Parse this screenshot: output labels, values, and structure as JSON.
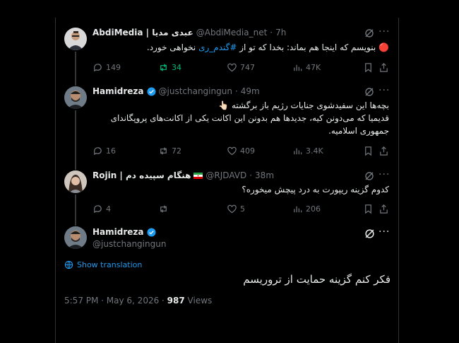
{
  "tweets": [
    {
      "name": "AbdiMedia | عبدی مدیا",
      "handle": "@AbdiMedia_net",
      "time": "7h",
      "text_before": "بنویسم که اینجا هم بماند: بخدا که تو از ",
      "hashtag": "#گندم_ری",
      "text_after": " نخواهی خورد.",
      "status_emoji": "🔴",
      "replies": "149",
      "reposts": "34",
      "likes": "747",
      "views": "47K"
    },
    {
      "name": "Hamidreza",
      "handle": "@justchangingun",
      "time": "49m",
      "line1": "بچه‌ها این سفیدشوی جنایات رژیم باز برگشته 👆🏻",
      "line2": "قدیمیا که می‌دونن کیه، جدیدها هم بدونن این اکانت یکی از اکانت‌های پروپگاندای",
      "line3": "جمهوری اسلامیه.",
      "replies": "16",
      "reposts": "72",
      "likes": "409",
      "views": "3.4K"
    },
    {
      "name": "Rojin | هنگام سپیده دم",
      "handle": "@RJDAVD",
      "time": "38m",
      "text": "کدوم گزینه ریپورت به درد پیچش میخوره؟",
      "replies": "4",
      "reposts": "",
      "likes": "5",
      "views": "206"
    }
  ],
  "main_tweet": {
    "name": "Hamidreza",
    "handle": "@justchangingun",
    "show_translation": "Show translation",
    "text": "فکر کنم گزینه حمایت از تروریسم",
    "timestamp": "5:57 PM · May 6, 2026 · ",
    "views_count": "987",
    "views_label": " Views"
  },
  "separator": "·",
  "more_glyph": "···",
  "colors": {
    "accent": "#1d9bf0",
    "repost_green": "#00ba7c",
    "muted": "#71767b"
  }
}
